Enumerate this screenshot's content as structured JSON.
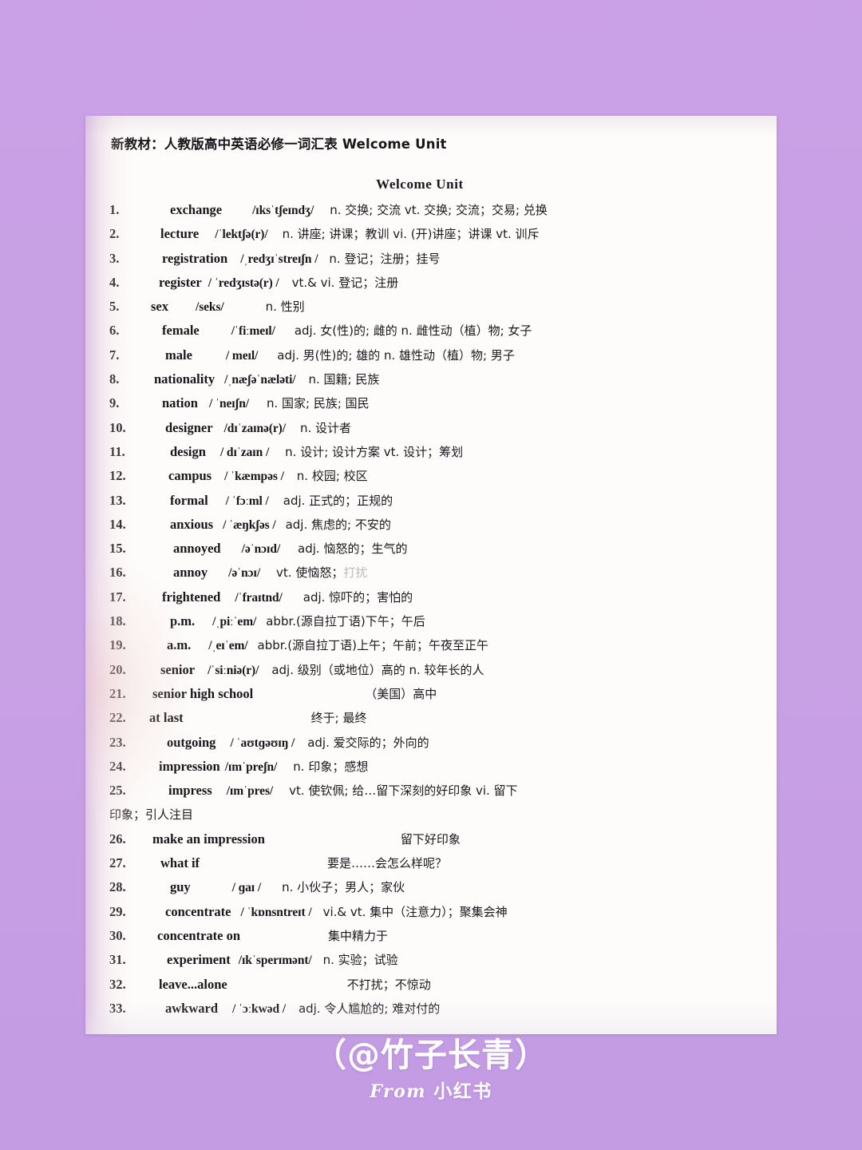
{
  "background": {
    "color": "#c8a0e4"
  },
  "document": {
    "header": "新教材：人教版高中英语必修一词汇表  Welcome Unit",
    "unit_title": "Welcome Unit",
    "entries": [
      {
        "num": "1.",
        "term": "exchange",
        "phonetic": "/ɪksˈtʃeɪndʒ/",
        "definition": "n.  交换; 交流  vt.  交换; 交流；交易; 兑换"
      },
      {
        "num": "2.",
        "term": "lecture",
        "phonetic": "/ˈlektʃə(r)/",
        "definition": "n.    讲座; 讲课；教训   vi.  (开)讲座；讲课  vt.  训斥"
      },
      {
        "num": "3.",
        "term": "registration",
        "phonetic": "/ˌredʒɪˈstreɪʃn /",
        "definition": "n.  登记；注册；挂号"
      },
      {
        "num": "4.",
        "term": "register",
        "phonetic": "/ ˈredʒɪstə(r) /",
        "definition": "vt.& vi.  登记；注册"
      },
      {
        "num": "5.",
        "term": "sex",
        "phonetic": "/seks/",
        "definition": "n.  性别"
      },
      {
        "num": "6.",
        "term": "female",
        "phonetic": "/ˈfiːmeɪl/",
        "definition": "adj.  女(性)的; 雌的   n.   雌性动（植）物; 女子"
      },
      {
        "num": "7.",
        "term": "male",
        "phonetic": "/ meɪl/",
        "definition": "adj.  男(性)的; 雄的   n.   雄性动（植）物; 男子"
      },
      {
        "num": "8.",
        "term": "nationality",
        "phonetic": "/ˌnæʃəˈnæləti/",
        "definition": "n.   国籍; 民族"
      },
      {
        "num": "9.",
        "term": "nation",
        "phonetic": "/ ˈneɪʃn/",
        "definition": "n.   国家; 民族; 国民"
      },
      {
        "num": "10.",
        "term": "designer",
        "phonetic": "/dɪˈzaɪnə(r)/",
        "definition": "n.   设计者"
      },
      {
        "num": "11.",
        "term": "design",
        "phonetic": "/ dɪˈzaɪn /",
        "definition": "n.   设计; 设计方案   vt.   设计；筹划"
      },
      {
        "num": "12.",
        "term": "campus",
        "phonetic": "/ ˈkæmpəs /",
        "definition": "n.   校园; 校区"
      },
      {
        "num": "13.",
        "term": "formal",
        "phonetic": "/ ˈfɔːml /",
        "definition": "adj.  正式的；正规的"
      },
      {
        "num": "14.",
        "term": "anxious",
        "phonetic": "/ ˈæŋkʃəs /",
        "definition": "adj. 焦虑的; 不安的"
      },
      {
        "num": "15.",
        "term": "annoyed",
        "phonetic": "/əˈnɔɪd/",
        "definition": "adj. 恼怒的；生气的"
      },
      {
        "num": "16.",
        "term": "annoy",
        "phonetic": "/əˈnɔɪ/",
        "definition": "vt.   使恼怒；",
        "definition_faded": "打扰"
      },
      {
        "num": "17.",
        "term": "frightened",
        "phonetic": "/ˈfraɪtnd/",
        "definition": "adj.  惊吓的；害怕的"
      },
      {
        "num": "18.",
        "term": "p.m.",
        "phonetic": "/ˌpiːˈem/",
        "definition": "abbr.(源自拉丁语)下午；午后"
      },
      {
        "num": "19.",
        "term": "a.m.",
        "phonetic": "/ˌeɪˈem/",
        "definition": "abbr.(源自拉丁语)上午；午前；午夜至正午"
      },
      {
        "num": "20.",
        "term": "senior",
        "phonetic": "/ˈsiːniə(r)/",
        "definition": "adj. 级别（或地位）高的   n. 较年长的人"
      },
      {
        "num": "21.",
        "term": "senior high school",
        "phonetic": "",
        "definition": "（美国）高中"
      },
      {
        "num": "22.",
        "term": "at last",
        "phonetic": "",
        "definition": "终于; 最终"
      },
      {
        "num": "23.",
        "term": "outgoing",
        "phonetic": "/ ˈaʊtɡəʊɪŋ /",
        "definition": "adj. 爱交际的；外向的"
      },
      {
        "num": "24.",
        "term": "impression",
        "phonetic": "/ɪmˈpreʃn/",
        "definition": "n.    印象；感想"
      },
      {
        "num": "25.",
        "term": "impress",
        "phonetic": "/ɪmˈpres/",
        "definition": "vt.   使钦佩; 给…留下深刻的好印象    vi. 留下",
        "continuation": "印象；引人注目"
      },
      {
        "num": "26.",
        "term": "make an impression",
        "phonetic": "",
        "definition": "留下好印象"
      },
      {
        "num": "27.",
        "term": "what if",
        "phonetic": "",
        "definition": "要是……会怎么样呢？"
      },
      {
        "num": "28.",
        "term": "guy",
        "phonetic": "/ ɡaɪ /",
        "definition": "n.    小伙子；男人；家伙"
      },
      {
        "num": "29.",
        "term": "concentrate",
        "phonetic": "/ ˈkɒnsntreɪt /",
        "definition": "vi.& vt.  集中（注意力）；聚集会神"
      },
      {
        "num": "30.",
        "term": "concentrate on",
        "phonetic": "",
        "definition": "集中精力于"
      },
      {
        "num": "31.",
        "term": "experiment",
        "phonetic": "/ɪkˈsperɪmənt/",
        "definition": "n.    实验；试验"
      },
      {
        "num": "32.",
        "term": "leave...alone",
        "phonetic": "",
        "definition": "不打扰；不惊动"
      },
      {
        "num": "33.",
        "term": "awkward",
        "phonetic": "/ ˈɔːkwəd /",
        "definition": "adj. 令人尴尬的; 难对付的"
      }
    ]
  },
  "watermark": {
    "handle": "（@竹子长青）",
    "from_prefix": "From",
    "from_source": "小红书"
  }
}
